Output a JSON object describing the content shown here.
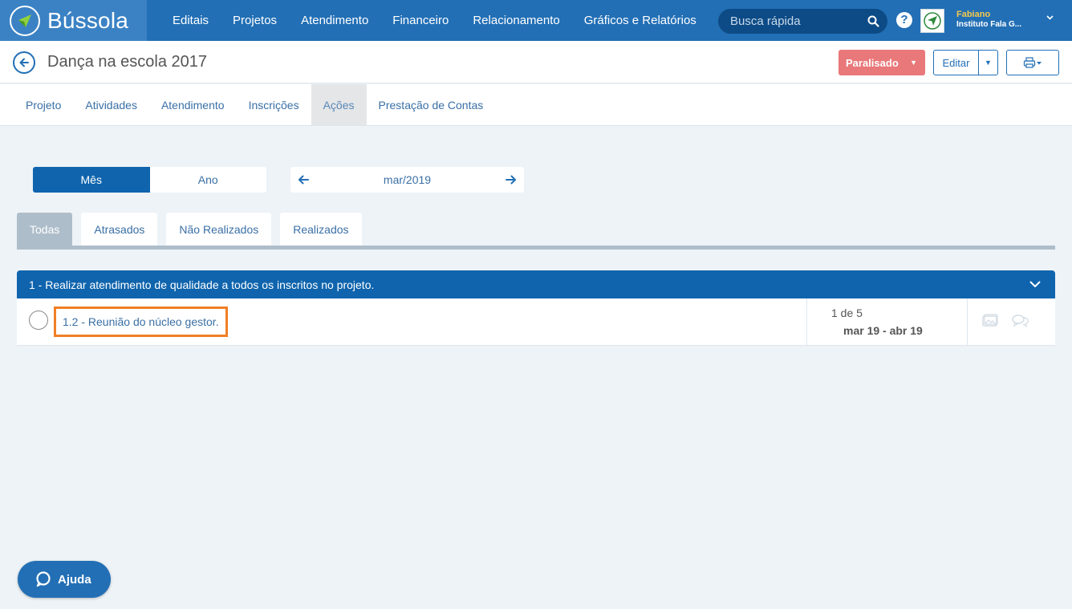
{
  "brand": {
    "name": "Bússola"
  },
  "nav": {
    "items": [
      {
        "label": "Editais"
      },
      {
        "label": "Projetos"
      },
      {
        "label": "Atendimento"
      },
      {
        "label": "Financeiro"
      },
      {
        "label": "Relacionamento"
      },
      {
        "label": "Gráficos e Relatórios"
      }
    ]
  },
  "search": {
    "placeholder": "Busca rápida",
    "icon": "search-icon"
  },
  "help": {
    "icon_label": "?"
  },
  "user": {
    "name": "Fabiano",
    "org": "Instituto Fala G..."
  },
  "project": {
    "title": "Dança na escola 2017",
    "status_label": "Paralisado",
    "edit_label": "Editar"
  },
  "project_tabs": [
    {
      "label": "Projeto",
      "active": false
    },
    {
      "label": "Atividades",
      "active": false
    },
    {
      "label": "Atendimento",
      "active": false
    },
    {
      "label": "Inscrições",
      "active": false
    },
    {
      "label": "Ações",
      "active": true
    },
    {
      "label": "Prestação de Contas",
      "active": false
    }
  ],
  "period": {
    "month_label": "Mês",
    "year_label": "Ano",
    "current": "mar/2019",
    "selected": "Mês"
  },
  "filter_tabs": [
    {
      "label": "Todas",
      "active": true
    },
    {
      "label": "Atrasados",
      "active": false
    },
    {
      "label": "Não Realizados",
      "active": false
    },
    {
      "label": "Realizados",
      "active": false
    }
  ],
  "goal": {
    "title": "1 - Realizar atendimento de qualidade a todos os inscritos no projeto.",
    "actions": [
      {
        "title": "1.2 - Reunião do núcleo gestor.",
        "count": "1 de 5",
        "dates": "mar 19 - abr 19"
      }
    ]
  },
  "help_button": {
    "label": "Ajuda"
  },
  "colors": {
    "primary": "#226fb5",
    "dark_primary": "#0f64ad",
    "status_paused": "#e9787a",
    "highlight": "#f07f26",
    "background": "#edf3f7"
  }
}
